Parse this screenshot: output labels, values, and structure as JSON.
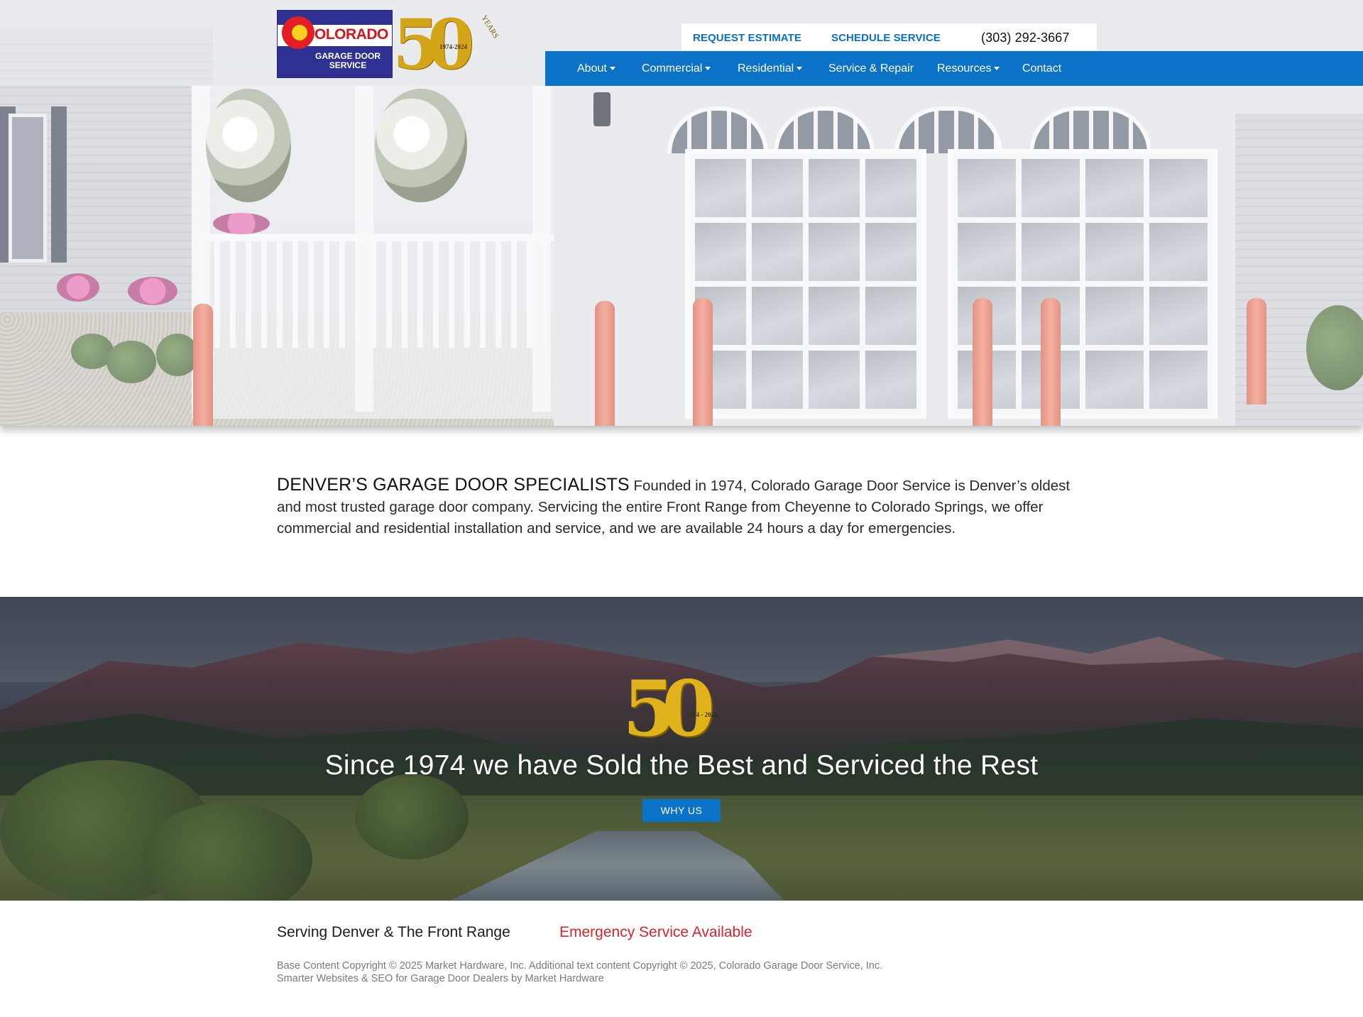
{
  "header": {
    "logo": {
      "brand_word": "OLORADO",
      "brand_sub": "GARAGE DOOR SERVICE",
      "anniversary_number": "50",
      "anniversary_years": "YEARS",
      "anniversary_range": "1974-2024"
    },
    "topbar": {
      "request_estimate": "REQUEST ESTIMATE",
      "schedule_service": "SCHEDULE SERVICE",
      "phone": "(303) 292-3667"
    },
    "nav": [
      {
        "label": "About",
        "dropdown": true
      },
      {
        "label": "Commercial",
        "dropdown": true
      },
      {
        "label": "Residential",
        "dropdown": true
      },
      {
        "label": "Service & Repair",
        "dropdown": false
      },
      {
        "label": "Resources",
        "dropdown": true
      },
      {
        "label": "Contact",
        "dropdown": false
      }
    ]
  },
  "intro": {
    "heading": "DENVER’S GARAGE DOOR SPECIALISTS",
    "body": "Founded in 1974, Colorado Garage Door Service is Denver’s oldest and most trusted garage door company. Servicing the entire Front Range from Cheyenne to Colorado Springs, we offer commercial and residential installation and service, and we are available 24 hours a day for emergencies."
  },
  "banner": {
    "logo_number": "50",
    "logo_range": "1974 - 2024",
    "title": "Since 1974 we have Sold the Best and Serviced the Rest",
    "button": "WHY US"
  },
  "footer": {
    "serving": "Serving Denver & The Front Range",
    "emergency": "Emergency Service Available",
    "copyright": "Base Content Copyright © 2025 Market Hardware, Inc. Additional text content Copyright © 2025, Colorado Garage Door Service, Inc. Smarter Websites & SEO for Garage Door Dealers by Market Hardware"
  },
  "colors": {
    "brand_blue": "#0a73c8",
    "emergency_red": "#d8242c",
    "logo_navy": "#2e3191",
    "logo_gold": "#d4a516"
  },
  "icons": {
    "nav_dropdown": "caret-down-icon"
  }
}
